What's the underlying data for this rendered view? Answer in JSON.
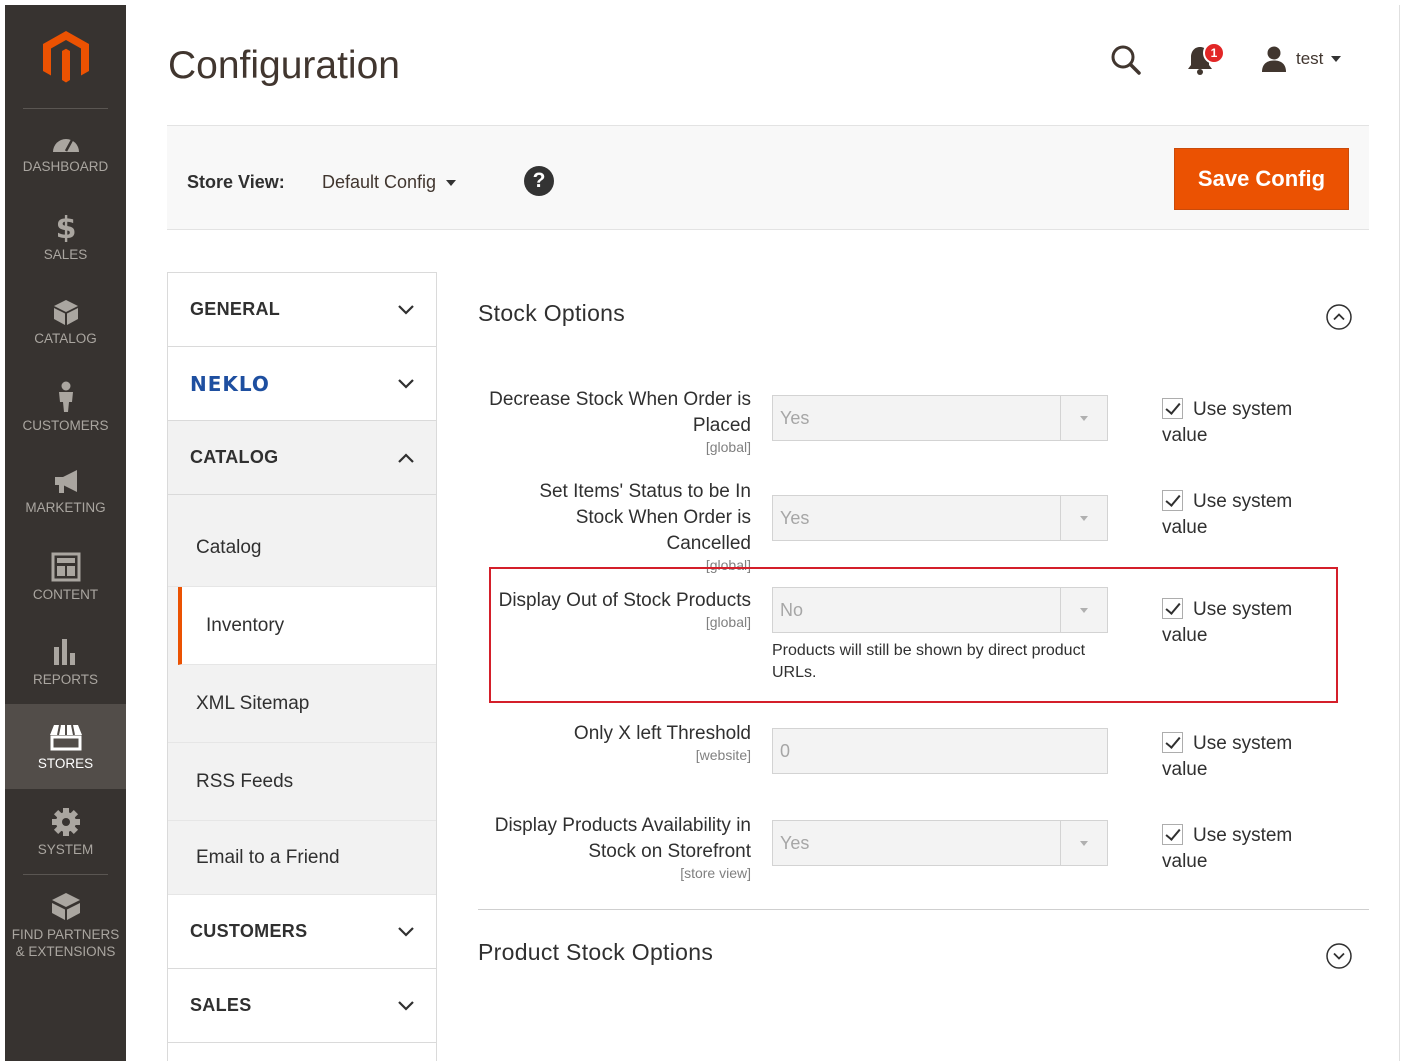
{
  "sidebar": {
    "items": [
      {
        "label": "DASHBOARD",
        "icon": "dashboard-icon"
      },
      {
        "label": "SALES",
        "icon": "dollar-icon"
      },
      {
        "label": "CATALOG",
        "icon": "box-icon"
      },
      {
        "label": "CUSTOMERS",
        "icon": "person-icon"
      },
      {
        "label": "MARKETING",
        "icon": "megaphone-icon"
      },
      {
        "label": "CONTENT",
        "icon": "layout-icon"
      },
      {
        "label": "REPORTS",
        "icon": "bar-chart-icon"
      },
      {
        "label": "STORES",
        "icon": "store-icon"
      },
      {
        "label": "SYSTEM",
        "icon": "gear-icon"
      },
      {
        "label": "FIND PARTNERS",
        "label2": "& EXTENSIONS",
        "icon": "extensions-icon"
      }
    ]
  },
  "header": {
    "title": "Configuration",
    "notification_count": "1",
    "user_name": "test"
  },
  "store_view": {
    "label": "Store View:",
    "value": "Default Config",
    "help": "?",
    "save_label": "Save Config"
  },
  "tabs": {
    "general": "GENERAL",
    "neklo": "NEKLO",
    "catalog": "CATALOG",
    "catalog_items": [
      "Catalog",
      "Inventory",
      "XML Sitemap",
      "RSS Feeds",
      "Email to a Friend"
    ],
    "customers": "CUSTOMERS",
    "sales": "SALES"
  },
  "section": {
    "title": "Stock Options",
    "rows": [
      {
        "label": "Decrease Stock When Order is Placed",
        "scope": "[global]",
        "value": "Yes",
        "use_system": "Use system value"
      },
      {
        "label": "Set Items' Status to be In Stock When Order is Cancelled",
        "scope": "[global]",
        "value": "Yes",
        "use_system": "Use system value"
      },
      {
        "label": "Display Out of Stock Products",
        "scope": "[global]",
        "value": "No",
        "note": "Products will still be shown by direct product URLs.",
        "use_system": "Use system value"
      },
      {
        "label": "Only X left Threshold",
        "scope": "[website]",
        "value": "0",
        "use_system": "Use system value"
      },
      {
        "label": "Display Products Availability in Stock on Storefront",
        "scope": "[store view]",
        "value": "Yes",
        "use_system": "Use system value"
      }
    ]
  },
  "section2": {
    "title": "Product Stock Options"
  },
  "colors": {
    "accent": "#eb5202",
    "sidebar_bg": "#373330",
    "highlight": "#d41f2a"
  }
}
